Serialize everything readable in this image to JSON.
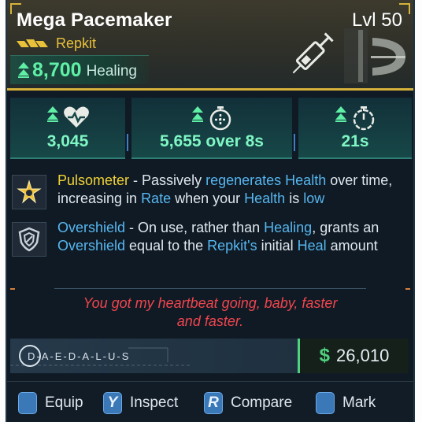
{
  "item": {
    "name": "Mega Pacemaker",
    "level": "Lvl 50",
    "rarity": "Repkit",
    "healing_value": "8,700",
    "healing_label": "Healing"
  },
  "stats": [
    {
      "icon": "heart-plus-icon",
      "value": "3,045"
    },
    {
      "icon": "timer-heal-icon",
      "value": "5,655 over 8s"
    },
    {
      "icon": "stopwatch-icon",
      "value": "21s"
    }
  ],
  "perks": [
    {
      "icon": "star-burst-icon",
      "parts": [
        "Pulsometer",
        " - Passively ",
        "regenerates",
        " ",
        "Health",
        " over time, increasing in ",
        "Rate",
        " when your ",
        "Health",
        " is ",
        "low"
      ]
    },
    {
      "icon": "shield-icon",
      "parts": [
        "Overshield",
        " - On use, rather than ",
        "Healing",
        ", grants an ",
        "Overshield",
        " equal to the ",
        "Repkit's",
        " initial ",
        "Heal",
        " amount"
      ]
    }
  ],
  "flavor": {
    "line1": "You got my heartbeat going, baby, faster",
    "line2": "and faster."
  },
  "manufacturer": "D-A-E-D-A-L-U-S",
  "price": {
    "symbol": "$",
    "value": "26,010"
  },
  "controls": [
    {
      "key": "",
      "label": "Equip"
    },
    {
      "key": "Y",
      "label": "Inspect"
    },
    {
      "key": "R",
      "label": "Compare"
    },
    {
      "key": "",
      "label": "Mark"
    }
  ],
  "colors": {
    "accent_gold": "#d6b23a",
    "heal_green": "#5ff0a6",
    "keyword_blue": "#57b6f0",
    "flavor_red": "#f0454e",
    "price_green": "#4fd27f"
  }
}
